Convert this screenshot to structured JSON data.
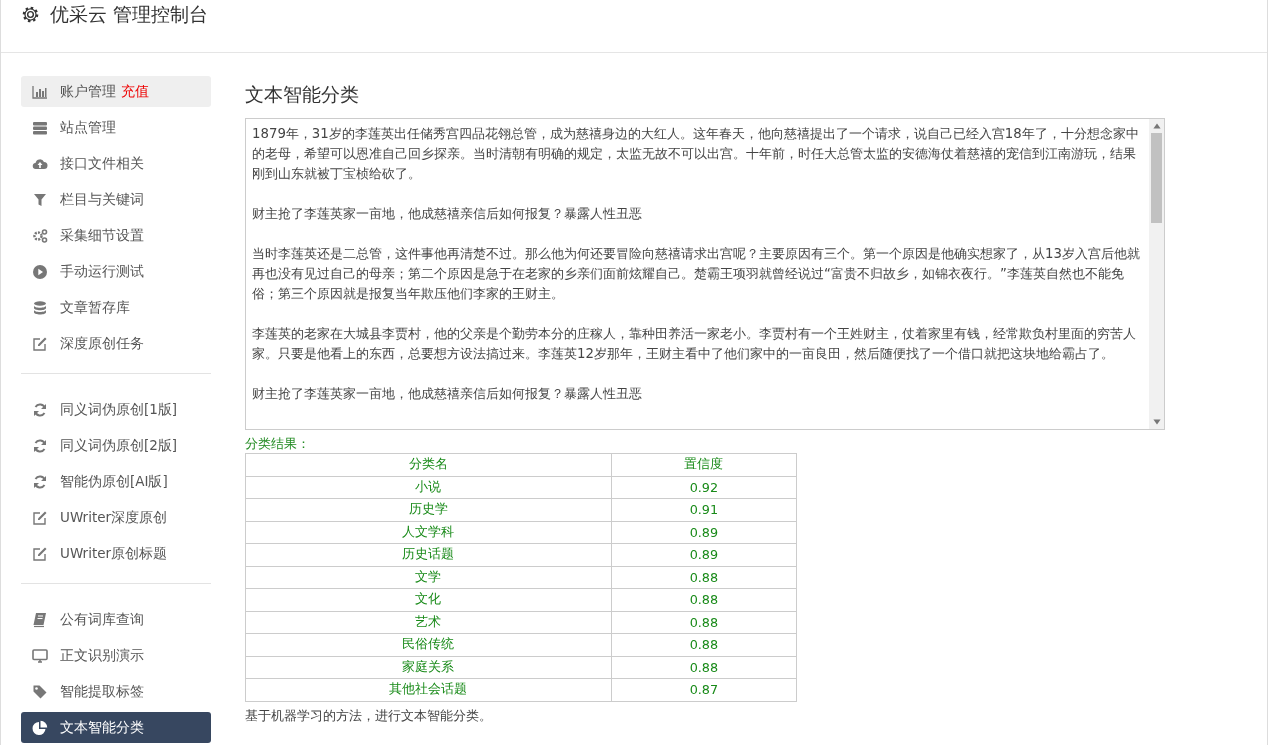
{
  "header": {
    "title": "优采云 管理控制台"
  },
  "sidebar": {
    "groups": [
      {
        "items": [
          {
            "label": "账户管理",
            "kind": "chart",
            "badge": "充值",
            "highlighted": true,
            "selected": false
          },
          {
            "label": "站点管理",
            "kind": "server",
            "highlighted": false,
            "selected": false
          },
          {
            "label": "接口文件相关",
            "kind": "cloud",
            "highlighted": false,
            "selected": false
          },
          {
            "label": "栏目与关键词",
            "kind": "filter",
            "highlighted": false,
            "selected": false
          },
          {
            "label": "采集细节设置",
            "kind": "gears",
            "highlighted": false,
            "selected": false
          },
          {
            "label": "手动运行测试",
            "kind": "play",
            "highlighted": false,
            "selected": false
          },
          {
            "label": "文章暂存库",
            "kind": "database",
            "highlighted": false,
            "selected": false
          },
          {
            "label": "深度原创任务",
            "kind": "edit",
            "highlighted": false,
            "selected": false
          }
        ]
      },
      {
        "items": [
          {
            "label": "同义词伪原创[1版]",
            "kind": "refresh",
            "highlighted": false,
            "selected": false
          },
          {
            "label": "同义词伪原创[2版]",
            "kind": "refresh",
            "highlighted": false,
            "selected": false
          },
          {
            "label": "智能伪原创[AI版]",
            "kind": "refresh",
            "highlighted": false,
            "selected": false
          },
          {
            "label": "UWriter深度原创",
            "kind": "edit",
            "highlighted": false,
            "selected": false
          },
          {
            "label": "UWriter原创标题",
            "kind": "edit",
            "highlighted": false,
            "selected": false
          }
        ]
      },
      {
        "items": [
          {
            "label": "公有词库查询",
            "kind": "book",
            "highlighted": false,
            "selected": false
          },
          {
            "label": "正文识别演示",
            "kind": "monitor",
            "highlighted": false,
            "selected": false
          },
          {
            "label": "智能提取标签",
            "kind": "tag",
            "highlighted": false,
            "selected": false
          },
          {
            "label": "文本智能分类",
            "kind": "pie",
            "highlighted": false,
            "selected": true
          }
        ]
      }
    ]
  },
  "main": {
    "title": "文本智能分类",
    "text_input": {
      "value": [
        "1879年，31岁的李莲英出任储秀宫四品花翎总管，成为慈禧身边的大红人。这年春天，他向慈禧提出了一个请求，说自己已经入宫18年了，十分想念家中的老母，希望可以恩准自己回乡探亲。当时清朝有明确的规定，太监无故不可以出宫。十年前，时任大总管太监的安德海仗着慈禧的宠信到江南游玩，结果刚到山东就被丁宝桢给砍了。",
        "财主抢了李莲英家一亩地，他成慈禧亲信后如何报复？暴露人性丑恶",
        "当时李莲英还是二总管，这件事他再清楚不过。那么他为何还要冒险向慈禧请求出宫呢？主要原因有三个。第一个原因是他确实想家了，从13岁入宫后他就再也没有见过自己的母亲；第二个原因是急于在老家的乡亲们面前炫耀自己。楚霸王项羽就曾经说过“富贵不归故乡，如锦衣夜行。”李莲英自然也不能免俗；第三个原因就是报复当年欺压他们李家的王财主。",
        "李莲英的老家在大城县李贾村，他的父亲是个勤劳本分的庄稼人，靠种田养活一家老小。李贾村有一个王姓财主，仗着家里有钱，经常欺负村里面的穷苦人家。只要是他看上的东西，总要想方设法搞过来。李莲英12岁那年，王财主看中了他们家中的一亩良田，然后随便找了一个借口就把这块地给霸占了。",
        "财主抢了李莲英家一亩地，他成慈禧亲信后如何报复？暴露人性丑恶"
      ]
    },
    "result_label": "分类结果：",
    "table": {
      "columns": [
        "分类名",
        "置信度"
      ],
      "rows": [
        [
          "小说",
          "0.92"
        ],
        [
          "历史学",
          "0.91"
        ],
        [
          "人文学科",
          "0.89"
        ],
        [
          "历史话题",
          "0.89"
        ],
        [
          "文学",
          "0.88"
        ],
        [
          "文化",
          "0.88"
        ],
        [
          "艺术",
          "0.88"
        ],
        [
          "民俗传统",
          "0.88"
        ],
        [
          "家庭关系",
          "0.88"
        ],
        [
          "其他社会话题",
          "0.87"
        ]
      ]
    },
    "footnote": "基于机器学习的方法，进行文本智能分类。"
  }
}
